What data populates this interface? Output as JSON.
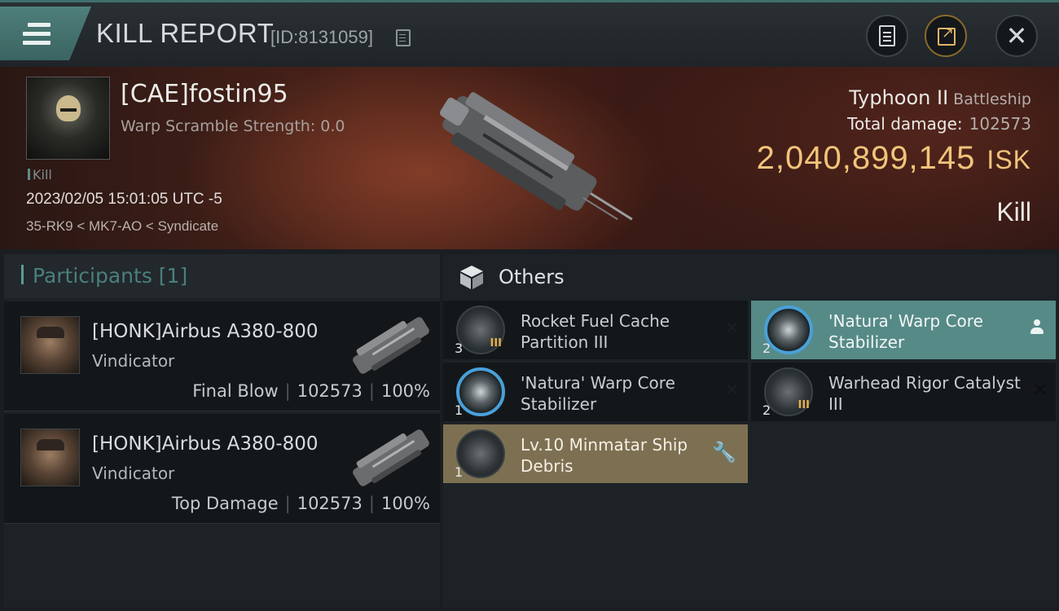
{
  "header": {
    "title": "KILL REPORT",
    "report_id": "[ID:8131059]"
  },
  "victim": {
    "name": "[CAE]fostin95",
    "warp_scramble": "Warp Scramble Strength: 0.0",
    "tag": "Kill",
    "timestamp": "2023/02/05 15:01:05 UTC -5",
    "location": "35-RK9 < MK7-AO < Syndicate",
    "ship_name": "Typhoon II",
    "ship_class": "Battleship",
    "total_damage_label": "Total damage:",
    "total_damage": "102573",
    "isk_value": "2,040,899,145",
    "isk_unit": "ISK",
    "result": "Kill"
  },
  "participants": {
    "label": "Participants [1]",
    "items": [
      {
        "name": "[HONK]Airbus A380-800",
        "ship": "Vindicator",
        "role": "Final Blow",
        "damage": "102573",
        "percent": "100%",
        "sep": "|"
      },
      {
        "name": "[HONK]Airbus A380-800",
        "ship": "Vindicator",
        "role": "Top Damage",
        "damage": "102573",
        "percent": "100%",
        "sep": "|"
      }
    ]
  },
  "others": {
    "label": "Others",
    "items": [
      {
        "name": "Rocket Fuel Cache Partition III",
        "qty": "3",
        "tier": "III",
        "action": "✕"
      },
      {
        "name": "'Natura' Warp Core Stabilizer",
        "qty": "2",
        "tier": "",
        "action": "person-icon"
      },
      {
        "name": "'Natura' Warp Core Stabilizer",
        "qty": "1",
        "tier": "",
        "action": "✕"
      },
      {
        "name": "Warhead Rigor Catalyst III",
        "qty": "2",
        "tier": "III",
        "action": "✕"
      },
      {
        "name": "Lv.10 Minmatar Ship Debris",
        "qty": "1",
        "tier": "",
        "action": "wrench-icon"
      }
    ]
  },
  "icons": {
    "menu": "menu-icon",
    "copy": "copy-icon",
    "notes": "clipboard-icon",
    "share": "share-icon",
    "close": "close-icon",
    "cube": "cube-icon"
  },
  "colors": {
    "accent": "#568a87",
    "isk": "#f0c47a",
    "destroyed_item": "#7d7052",
    "dropped_item": "#568a87"
  }
}
